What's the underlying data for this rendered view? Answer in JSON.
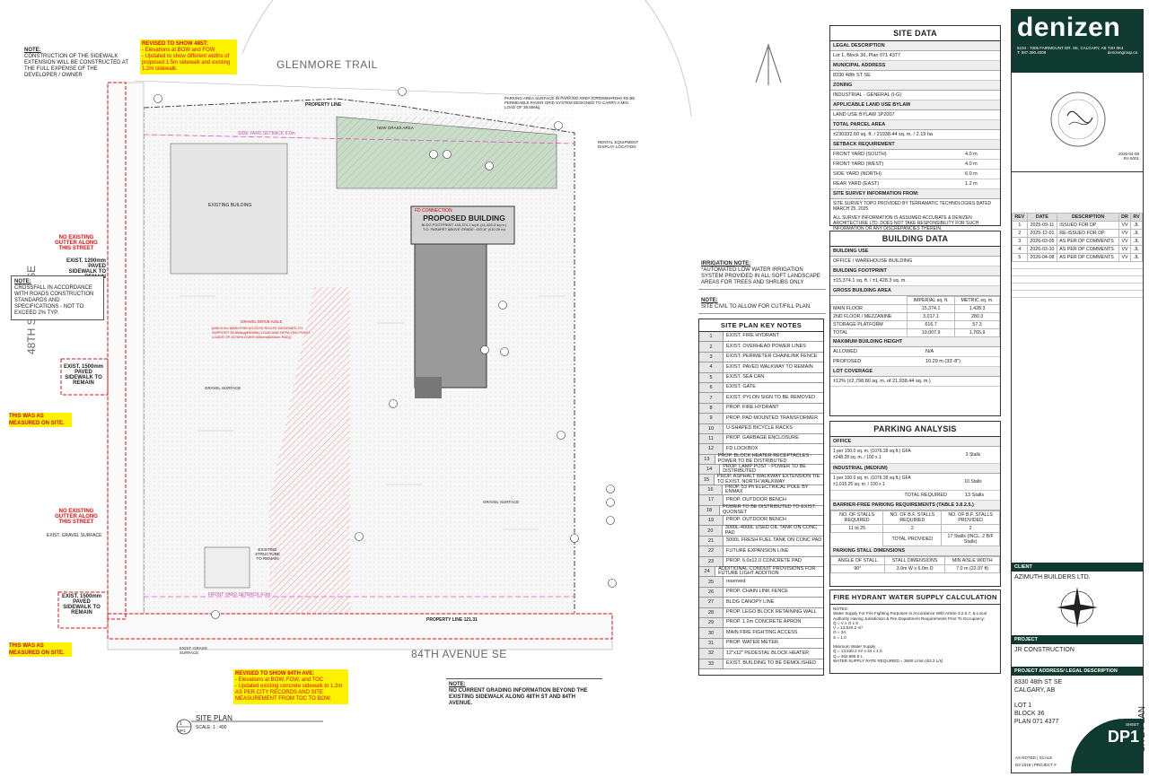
{
  "plan": {
    "street_top": "GLENMORE TRAIL",
    "street_left": "48TH STREET SE",
    "street_bottom": "84TH AVENUE SE",
    "building_name": "PROPOSED BUILDING",
    "building_footprint": "BLDG FOOTPRINT: ±15,374.1 sq.ft. (±1,428.3 sq.m.)",
    "building_parapet": "T.O. PARAPET ABOVE GRADE: ±33'-8\" (±10.29 m)",
    "fd_connection": "FD CONNECTION",
    "existing_building": "EXISTING BUILDING",
    "existing_structure": "EXISTING STRUCTURE TO REMAIN",
    "property_line_top": "PROPERTY LINE",
    "property_line_bottom": "PROPERTY LINE 121.31",
    "setback_side": "SIDE YARD SETBACK 6.0m",
    "setback_front": "FRONT YARD SETBACK 4.0m",
    "gravel_drive": "GRAVEL DRIVE AISLE",
    "fire_route": "(MIN 6.0m MAIN FIRE ACCESS ROUTE DESIGNED TO SUPPORT 38,556kg(85000lb) LOAD AND NFPA 1901 POINT LOADS OF 517kPa OVER 600mm(600mm PAD))",
    "gravel_surface": "GRAVEL SURFACE",
    "exist_grass": "EXIST. GRASS SURFACE",
    "parking_surface_note": "PARKING AREA SURFACE IN PARKING AREA (CROSSHATCH) TO BE PERMEABLE PAVER GRID SYSTEM DESIGNED TO CARRY A MIN. LOAD OF 38,556kg",
    "rental_equipment": "RENTAL EQUIPMENT DISPLAY LOCATION",
    "new_grass": "NEW GRASS AREA",
    "plan_title": "SITE PLAN",
    "plan_scale": "SCALE: 1 : 400",
    "plan_num_top": "1",
    "plan_num_bottom": "DP1",
    "sidewalk_left_1": "EXIST. 1200mm PAVED SIDEWALK TO REMAIN",
    "sidewalk_left_2": "EXIST. 1500mm PAVED SIDEWALK TO REMAIN",
    "sidewalk_left_3": "EXIST. 1500mm PAVED SIDEWALK TO REMAIN",
    "no_gutter_1": "NO EXISTING GUTTER ALONG THIS STREET",
    "no_gutter_2": "NO EXISTING GUTTER ALONG THIS STREET",
    "measured_1": "THIS WAS AS MEASURED ON SITE.",
    "measured_2": "THIS WAS AS MEASURED ON SITE.",
    "exist_gravel": "EXIST. GRAVEL SURFACE"
  },
  "notes": {
    "note1_title": "NOTE:",
    "note1_body": "CONSTRUCTION OF THE SIDEWALK EXTENSION WILL BE CONSTRUCTED AT THE FULL EXPENSE OF THE DEVELOPER / OWNER",
    "revised48_title": "REVISED TO SHOW 48ST:",
    "revised48_l1": "- Elevations at BOW and FOW",
    "revised48_l2": "- Updated to show different widths of proposed 1.5m sidewalk and existing 1.2m sidewalk.",
    "note2_title": "NOTE:",
    "note2_body": "CROSSFALL IN ACCORDANCE WITH ROADS CONSTRUCTION STANDARDS AND SPECIFICATIONS - NOT TO EXCEED 2% TYP.",
    "revised84_title": "REVISED TO SHOW 84TH AVE:",
    "revised84_l1": "- Elevations at BOW, FOW, and TOC",
    "revised84_l2": "- Updated existing concrete sidewalk to 1.2m AS PER CITY RECORDS AND SITE MEASUREMENT FROM TOC TO BOW.",
    "irrigation_title": "IRRIGATION NOTE:",
    "irrigation_body": "*AUTOMATED LOW WATER IRRIGATION SYSTEM PROVIDED IN ALL SOFT LANDSCAPE AREAS FOR TREES AND SHRUBS ONLY",
    "note3_title": "NOTE:",
    "note3_body": "SITE CIVIL TO ALLOW FOR CUT/FILL PLAN.",
    "note4_title": "NOTE:",
    "note4_body": "NO CURRENT GRADING INFORMATION BEYOND THE EXISTING SIDEWALK ALONG 48TH ST AND 84TH AVENUE."
  },
  "site_data": {
    "title": "SITE DATA",
    "legal_h": "LEGAL DESCRIPTION",
    "legal_v": "Lot 1, Block 36, Plan 071 4377",
    "municipal_h": "MUNICIPAL ADDRESS",
    "municipal_v": "8330 48th ST SE",
    "zoning_h": "ZONING",
    "zoning_v": "INDUSTRIAL - GENERAL (I-G)",
    "bylaw_h": "APPLICABLE LAND USE BYLAW",
    "bylaw_v": "LAND USE BYLAW 1P2007",
    "parcel_h": "TOTAL PARCEL AREA",
    "parcel_v": "±230332.60 sq. ft. / 21938.44 sq. m. / 2.19 ha",
    "setback_h": "SETBACK REQUIREMENT",
    "setbacks": [
      {
        "k": "FRONT YARD (SOUTH)",
        "v": "4.0 m"
      },
      {
        "k": "FRONT YARD (WEST)",
        "v": "4.0 m"
      },
      {
        "k": "SIDE YARD (NORTH)",
        "v": "6.0 m"
      },
      {
        "k": "REAR YARD (EAST)",
        "v": "1.2 m"
      }
    ],
    "survey_h": "SITE SURVEY INFORMATION FROM:",
    "survey_v1": "SITE SURVEY TOPO PROVIDED BY TERRAMATIC TECHNOLOGIES DATED MARCH 25, 2025",
    "survey_v2": "ALL SURVEY INFORMATION IS ASSUMED ACCURATE & DENIZEN ARCHITECTURE LTD. DOES NOT TAKE RESPONSIBILITY FOR SUCH INFORMATION OR ANY DISCREPANCIES THEREIN."
  },
  "building_data": {
    "title": "BUILDING DATA",
    "use_h": "BUILDING USE",
    "use_v": "OFFICE / WAREHOUSE BUILDING",
    "foot_h": "BUILDING FOOTPRINT",
    "foot_v": "±15,374.1 sq. ft. / ±1,428.3 sq. m.",
    "gross_h": "GROSS BUILDING AREA",
    "col_imp": "IMPERIAL sq. ft.",
    "col_met": "METRIC sq. m.",
    "rows": [
      {
        "k": "MAIN FLOOR",
        "i": "15,374.1",
        "m": "1,428.3"
      },
      {
        "k": "2ND FLOOR / MEZZANINE",
        "i": "3,017.1",
        "m": "280.3"
      },
      {
        "k": "STORAGE PLATFORM",
        "i": "616.7",
        "m": "57.3"
      },
      {
        "k": "TOTAL",
        "i": "19,007.9",
        "m": "1,765.9"
      }
    ],
    "height_h": "MAXIMUM BUILDING HEIGHT",
    "allowed_k": "ALLOWED",
    "allowed_v": "N/A",
    "proposed_k": "PROPOSED",
    "proposed_v": "10.29 m (33'-8\")",
    "coverage_h": "LOT COVERAGE",
    "coverage_v": "±12% (±2,798.80 sq. m. of 21,938.44 sq. m.)"
  },
  "parking": {
    "title": "PARKING ANALYSIS",
    "office_h": "OFFICE",
    "office_l1": "1 per 100.0 sq. m. (1076.39 sq.ft.) GFA",
    "office_l2": "±248.28 sq. m. / 100 x 1",
    "office_v": "3 Stalls",
    "ind_h": "INDUSTRIAL (MEDIUM)",
    "ind_l1": "1 per 100.0 sq. m. (1076.39 sq.ft.) GFA",
    "ind_l2": "±1,015.25 sq. m. / 100 x 1",
    "ind_v": "10 Stalls",
    "total_req_k": "TOTAL REQUIRED",
    "total_req_v": "13 Stalls",
    "bf_h": "BARRIER-FREE PARKING REQUIREMENTS (TABLE 3.8.2.5.)",
    "bf_c1": "NO. OF STALLS REQUIRED",
    "bf_c2": "NO. OF B.F. STALLS REQUIRED",
    "bf_c3": "NO. OF B.F. STALLS PROVIDED",
    "bf_v1": "11 to 25",
    "bf_v2": "2",
    "bf_v3": "2",
    "total_prov_k": "TOTAL PROVIDED",
    "total_prov_v": "17 Stalls (INCL. 2 B/F Stalls)",
    "dim_h": "PARKING STALL DIMENSIONS",
    "dim_c1": "ANGLE OF STALL",
    "dim_c2": "STALL DIMENSIONS",
    "dim_c3": "MIN AISLE WIDTH",
    "dim_v1": "90°",
    "dim_v2": "3.0m W x 6.0m D",
    "dim_v3": "7.0 m (22.97 ft)"
  },
  "hydrant": {
    "title": "FIRE HYDRANT WATER SUPPLY CALCULATION",
    "notes_h": "NOTES:",
    "notes_v": "Water Supply For Fire Fighting Purposes In Accordance With Article 3.2.5.7. & Local Authority Having Jurisdiction & Fire Department Requirements Prior To Occupancy:",
    "calc": [
      "Q = V x O x S",
      "V = 13,520.2 m³",
      "O = 34",
      "S = 1.0",
      "",
      "Minimum Water Supply",
      "Q = 13,520.2 m³ x 34 x 1.0",
      "Q = 462,886.8 L",
      "WATER SUPPLY RATE REQUIRED = 3600 L/min (63.3 L/s)"
    ]
  },
  "key_notes": {
    "title": "SITE PLAN KEY NOTES",
    "items": [
      "EXIST. FIRE HYDRANT",
      "EXIST. OVERHEAD POWER LINES",
      "EXIST. PERIMETER CHAINLINK FENCE",
      "EXIST. PAVED WALKWAY TO REMAIN",
      "EXIST. SEA CAN",
      "EXIST. GATE",
      "EXIST. PYLON SIGN TO BE REMOVED",
      "PROP. FIRE HYDRANT",
      "PROP. PAD MOUNTED TRANSFORMER",
      "U-SHAPED BICYCLE RACKS",
      "PROP. GARBAGE ENCLOSURE",
      "FD LOCKBOX",
      "PROP. BLOCK HEATER RECEPTACLES - POWER TO BE DISTRIBUTED",
      "PROP. LAMP POST - POWER TO BE DISTRIBUTED",
      "PROP. ASPHALT WALKWAY EXTENSION TIE TO EXIST. NORTH WALKWAY",
      "PROP. 53 Ph ELECTRICAL POLE BY ENMAX",
      "PROP. OUTDOOR BENCH",
      "POWER TO BE DISTRIBUTED TO EXIST. QUONSET",
      "PROP. OUTDOOR BENCH",
      "3000L-4000L USED OIL TANK ON CONC PAD",
      "5000L FRESH FUEL TANK ON CONC PAD",
      "FUTURE EXPANSION LINE",
      "PROP. 6.0x12.0 CONCRETE PAD",
      "ADDITIONAL CONDUIT PROVISIONS FOR FUTURE LIGHT ADDITION",
      "reserved",
      "PROP. CHAIN LINK FENCE",
      "BLDG CANOPY LINE",
      "PROP. LEGO BLOCK RETAINING WALL",
      "PROP. 1.2m CONCRETE APRON",
      "MAIN FIRE FIGHTING ACCESS",
      "PROP. WATER METER",
      "12\"x12\" PEDESTAL BLOCK HEATER",
      "EXIST. BUILDING TO BE DEMOLISHED"
    ]
  },
  "titleblock": {
    "brand": "denizen",
    "address": "5104 - 7005 FAIRMOUNT DR. SE, CALGARY, AB T2H 0K4",
    "phone": "T: 587.390.4008",
    "web": "denizengroup.ca",
    "stamp_date": "2026-04-08",
    "stamp_no": "RA 5001",
    "rev_cols": [
      "REV",
      "DATE",
      "DESCRIPTION",
      "DR",
      "RV"
    ],
    "revisions": [
      [
        "1",
        "2025-09-11",
        "ISSUED FOR DP",
        "VV",
        "JL"
      ],
      [
        "2",
        "2025-12-01",
        "RE-ISSUED FOR DP",
        "VV",
        "JL"
      ],
      [
        "3",
        "2026-03-05",
        "AS PER DP COMMENTS",
        "VV",
        "JL"
      ],
      [
        "4",
        "2026-03-10",
        "AS PER DP COMMENTS",
        "VV",
        "JL"
      ],
      [
        "5",
        "2026-04-08",
        "AS PER DP COMMENTS",
        "VV",
        "JL"
      ]
    ],
    "client_h": "CLIENT",
    "client_v": "AZIMUTH BUILDERS LTD.",
    "project_h": "PROJECT",
    "project_v": "JR CONSTRUCTION",
    "addr_h": "PROJECT ADDRESS/ LEGAL DESCRIPTION",
    "addr_1": "8330 48th ST SE",
    "addr_2": "CALGARY, AB",
    "lot": "LOT 1",
    "block": "BLOCK 36",
    "plan": "PLAN 071 4377",
    "sheet_title": "SITE PLAN",
    "sheet_label": "SHEET",
    "sheet_num": "DP1",
    "scale_note": "AS NOTED | SCALE",
    "project_no": "D2-1019 | PROJECT #"
  },
  "colors": {
    "accent_green": "#0f3a2f",
    "revision_red": "#e01010",
    "highlight_yellow": "#fff200"
  }
}
